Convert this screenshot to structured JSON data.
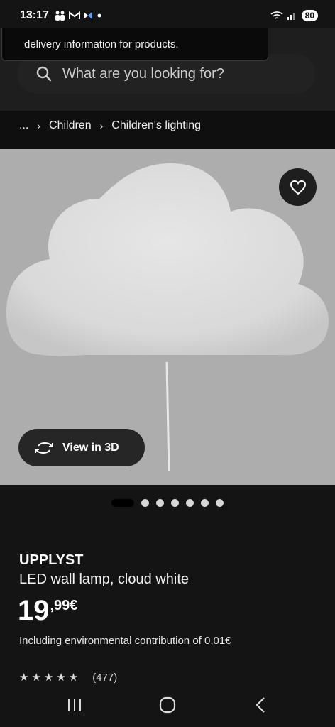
{
  "status": {
    "time": "13:17",
    "battery": "80",
    "left_icons": [
      "people-icon",
      "gmail-icon",
      "app-icon",
      "dot-icon"
    ]
  },
  "tooltip": {
    "text": "delivery information for products."
  },
  "search": {
    "placeholder": "What are you looking for?"
  },
  "breadcrumb": {
    "ellipsis": "...",
    "items": [
      "Children",
      "Children's lighting"
    ]
  },
  "gallery": {
    "view3d_label": "View in 3D",
    "dots_count": 7,
    "active_dot": 0
  },
  "product": {
    "name": "UPPLYST",
    "description": "LED wall lamp, cloud white",
    "price_int": "19",
    "price_dec": ",99€",
    "env_note": "Including environmental contribution of 0,01€",
    "rating_stars": "★★★★★",
    "review_count": "(477)"
  }
}
